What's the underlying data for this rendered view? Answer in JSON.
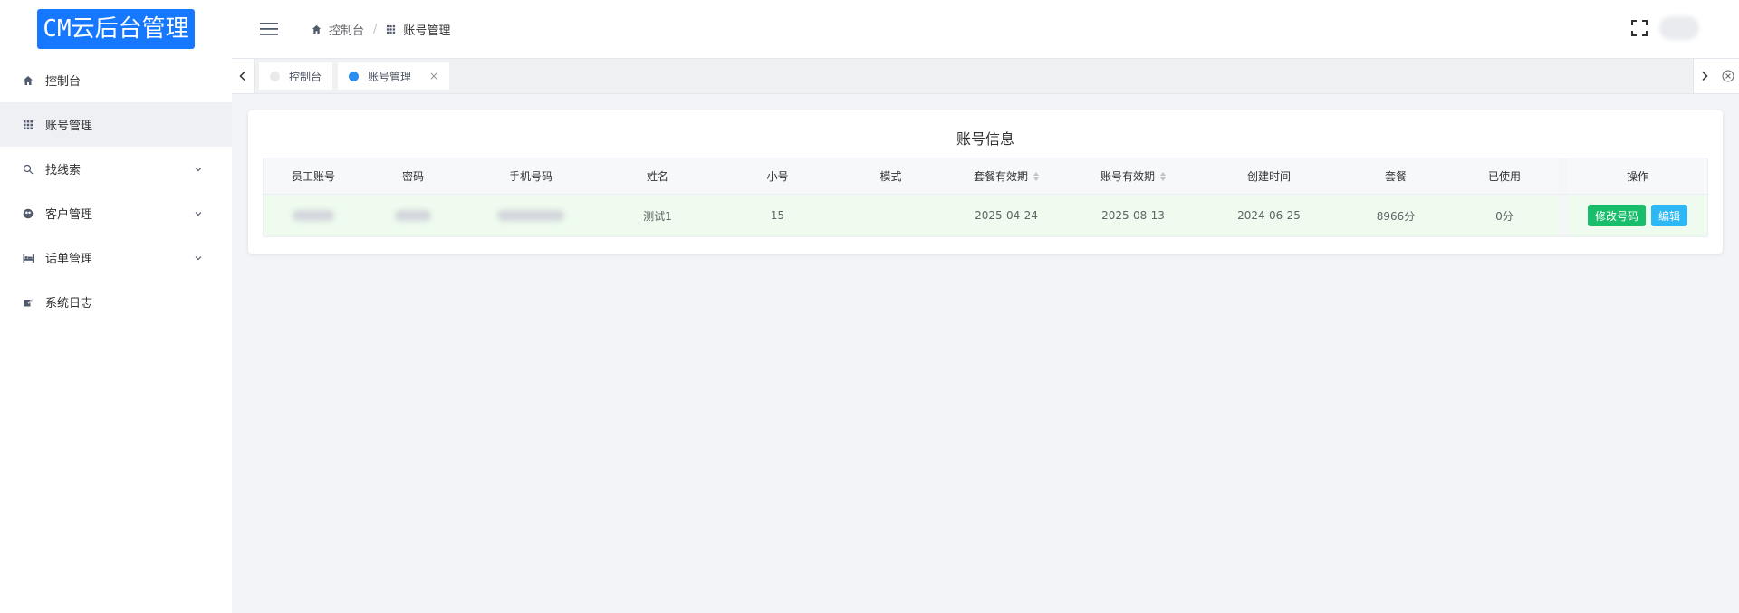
{
  "app": {
    "logo_text": "CM云后台管理"
  },
  "sidebar": {
    "items": [
      {
        "label": "控制台",
        "icon": "home-icon",
        "active": false,
        "has_children": false
      },
      {
        "label": "账号管理",
        "icon": "grid-icon",
        "active": true,
        "has_children": false
      },
      {
        "label": "找线索",
        "icon": "search-icon",
        "active": false,
        "has_children": true
      },
      {
        "label": "客户管理",
        "icon": "users-icon",
        "active": false,
        "has_children": true
      },
      {
        "label": "话单管理",
        "icon": "bed-icon",
        "active": false,
        "has_children": true
      },
      {
        "label": "系统日志",
        "icon": "edit-icon",
        "active": false,
        "has_children": false
      }
    ]
  },
  "header": {
    "breadcrumb": [
      {
        "label": "控制台",
        "icon": "home-icon"
      },
      {
        "label": "账号管理",
        "icon": "grid-icon"
      }
    ],
    "separator": "/"
  },
  "tabs": [
    {
      "label": "控制台",
      "active": false,
      "closable": false
    },
    {
      "label": "账号管理",
      "active": true,
      "closable": true,
      "close_glyph": "×"
    }
  ],
  "card": {
    "title": "账号信息",
    "columns": [
      "员工账号",
      "密码",
      "手机号码",
      "姓名",
      "小号",
      "模式",
      "套餐有效期",
      "账号有效期",
      "创建时间",
      "套餐",
      "已使用",
      "操作"
    ],
    "rows": [
      {
        "employee_account": "",
        "password": "",
        "phone": "",
        "name": "测试1",
        "sub_number": "15",
        "mode": "",
        "package_expiry": "2025-04-24",
        "account_expiry": "2025-08-13",
        "created": "2024-06-25",
        "package": "8966分",
        "used": "0分"
      }
    ],
    "actions": {
      "modify_label": "修改号码",
      "edit_label": "编辑"
    }
  },
  "colors": {
    "brand": "#1677ff",
    "active_dot": "#2d8cf0",
    "btn_green": "#19be6b",
    "btn_blue": "#2db7f5",
    "row_bg": "#eefbee"
  }
}
